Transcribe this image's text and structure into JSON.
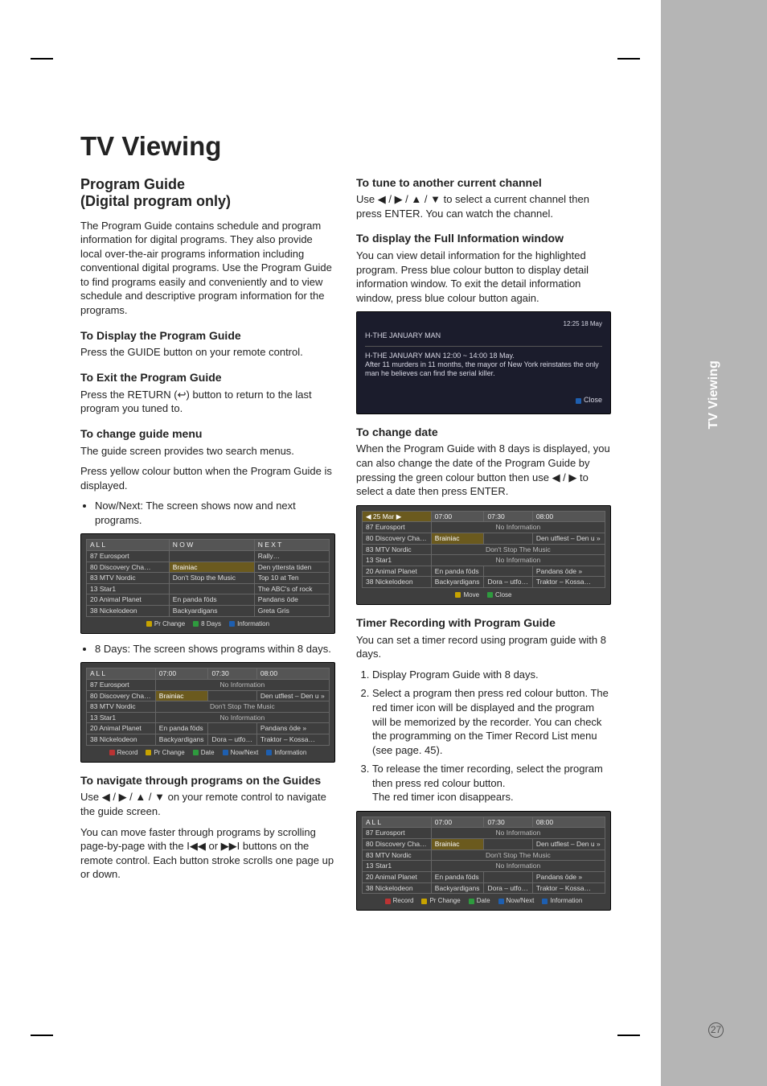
{
  "sideTab": "TV Viewing",
  "pageNumber": "27",
  "title": "TV Viewing",
  "left": {
    "h2": "Program Guide\n(Digital program only)",
    "intro": "The Program Guide contains schedule and program information for digital programs. They also provide local over-the-air programs information including conventional digital programs. Use the Program Guide to find programs easily and conveniently and to view schedule and descriptive program information for the programs.",
    "s1h": "To Display the Program Guide",
    "s1p": "Press the GUIDE button on your remote control.",
    "s2h": "To Exit the Program Guide",
    "s2p_a": "Press the RETURN (",
    "s2p_b": ") button to return to the last program you tuned to.",
    "return_sym": "↩",
    "s3h": "To change guide menu",
    "s3p1": "The guide screen provides two search menus.",
    "s3p2": "Press yellow colour button when the Program Guide is displayed.",
    "s3b1": "Now/Next: The screen shows now and next programs.",
    "s3b2": "8 Days: The screen shows programs within 8 days.",
    "s4h": "To navigate through programs on the Guides",
    "s4p1_a": "Use ",
    "s4p1_b": " on your remote control to navigate the guide screen.",
    "s4arrows": "◀ / ▶ / ▲ / ▼",
    "s4p2_a": "You can move faster through programs by scrolling page-by-page with the ",
    "s4p2_b": " or ",
    "s4p2_c": " buttons on the remote control. Each button stroke scrolls one page up or down.",
    "skipback": "I◀◀",
    "skipfwd": "▶▶I"
  },
  "right": {
    "s5h": "To tune to another current channel",
    "s5p_a": "Use ",
    "s5arrows": "◀ / ▶ / ▲ / ▼",
    "s5p_b": " to select a current channel then press ENTER. You can watch the channel.",
    "s6h": "To display the Full Information window",
    "s6p": "You can view detail information for the highlighted program. Press blue colour button to display detail information window. To exit the detail information window, press blue colour button again.",
    "s7h": "To change date",
    "s7p_a": "When the Program Guide with 8 days is displayed, you can also change the date of the Program Guide by pressing the green colour button then use ",
    "s7arrows": "◀ / ▶",
    "s7p_b": " to select a date then press ENTER.",
    "s8h": "Timer Recording with Program Guide",
    "s8p": "You can set a timer record using program guide with 8 days.",
    "step1": "Display Program Guide with 8 days.",
    "step2": "Select a program then press red colour button. The red timer icon will be displayed and the program will be memorized by the recorder. You can check the programming on the Timer Record List menu (see page. 45).",
    "step3": "To release the timer recording, select the program then press red colour button.\nThe red timer icon disappears."
  },
  "shotA": {
    "head_all": "A L L",
    "head_now": "N O W",
    "head_next": "N E X T",
    "channels": [
      "87 Eurosport",
      "80 Discovery Cha…",
      "83 MTV Nordic",
      "13 Star1",
      "20 Animal Planet",
      "38 Nickelodeon"
    ],
    "now": [
      "",
      "Brainiac",
      "Don't Stop the Music",
      "",
      "En panda föds",
      "Backyardigans"
    ],
    "next": [
      "Rally…",
      "Den yttersta tiden",
      "Top 10 at Ten",
      "The ABC's of rock",
      "Pandans öde",
      "Greta Gris"
    ],
    "legend_prchange": "Pr Change",
    "legend_8days": "8 Days",
    "legend_info": "Information"
  },
  "shotB": {
    "head_all": "A L L",
    "times": [
      "07:00",
      "07:30",
      "08:00"
    ],
    "channels": [
      "87 Eurosport",
      "80 Discovery Cha…",
      "83 MTV Nordic",
      "13 Star1",
      "20 Animal Planet",
      "38 Nickelodeon"
    ],
    "rows": [
      [
        "No Information",
        "",
        ""
      ],
      [
        "Brainiac",
        "",
        "Den utflest – Den u »"
      ],
      [
        "Don't Stop The Music",
        "",
        ""
      ],
      [
        "No Information",
        "",
        ""
      ],
      [
        "En panda föds",
        "",
        "Pandans öde »"
      ],
      [
        "Backyardigans",
        "Dora – utfo…",
        "Traktor – Kossa…"
      ]
    ],
    "legend_record": "Record",
    "legend_prchange": "Pr Change",
    "legend_date": "Date",
    "legend_nownext": "Now/Next",
    "legend_info": "Information"
  },
  "shotInfo": {
    "timebar": "12:25  18 May",
    "title": "H-THE JANUARY MAN",
    "line1": "H-THE JANUARY MAN  12:00 ~ 14:00 18 May.",
    "line2": "After 11 murders in 11 months, the mayor of New York reinstates the only man he believes can find the serial killer.",
    "close": "Close"
  },
  "shotC": {
    "date": "25 Mar",
    "times": [
      "07:00",
      "07:30",
      "08:00"
    ],
    "channels": [
      "87 Eurosport",
      "80 Discovery Cha…",
      "83 MTV Nordic",
      "13 Star1",
      "20 Animal Planet",
      "38 Nickelodeon"
    ],
    "rows": [
      [
        "No Information",
        "",
        ""
      ],
      [
        "Brainiac",
        "",
        "Den utflest – Den u »"
      ],
      [
        "Don't Stop The Music",
        "",
        ""
      ],
      [
        "No Information",
        "",
        ""
      ],
      [
        "En panda föds",
        "",
        "Pandans öde »"
      ],
      [
        "Backyardigans",
        "Dora – utfo…",
        "Traktor – Kossa…"
      ]
    ],
    "legend_move": "Move",
    "legend_close": "Close"
  },
  "shotD": {
    "head_all": "A L L",
    "times": [
      "07:00",
      "07:30",
      "08:00"
    ],
    "channels": [
      "87 Eurosport",
      "80 Discovery Cha…",
      "83 MTV Nordic",
      "13 Star1",
      "20 Animal Planet",
      "38 Nickelodeon"
    ],
    "rows": [
      [
        "No Information",
        "",
        ""
      ],
      [
        "Brainiac",
        "",
        "Den utflest – Den u »"
      ],
      [
        "Don't Stop The Music",
        "",
        ""
      ],
      [
        "No Information",
        "",
        ""
      ],
      [
        "En panda föds",
        "",
        "Pandans öde »"
      ],
      [
        "Backyardigans",
        "Dora – utfo…",
        "Traktor – Kossa…"
      ]
    ],
    "legend_record": "Record",
    "legend_prchange": "Pr Change",
    "legend_date": "Date",
    "legend_nownext": "Now/Next",
    "legend_info": "Information"
  }
}
